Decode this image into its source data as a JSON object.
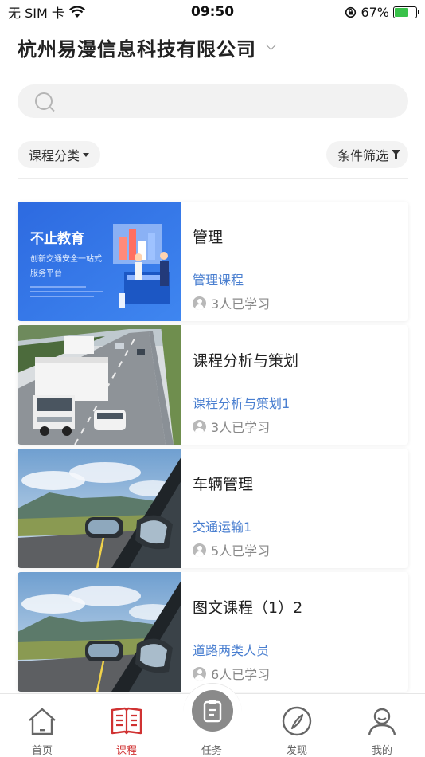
{
  "status": {
    "carrier": "无 SIM 卡",
    "time": "09:50",
    "battery": "67%",
    "battery_level": 0.67
  },
  "header": {
    "company_name": "杭州易漫信息科技有限公司"
  },
  "search": {
    "placeholder": ""
  },
  "filters": {
    "category_label": "课程分类",
    "condition_label": "条件筛选"
  },
  "banner": {
    "title": "不止教育",
    "line1": "创新交通安全一站式",
    "line2": "服务平台"
  },
  "courses": [
    {
      "title": "管理",
      "category": "管理课程",
      "learners": "3人已学习",
      "thumb": "banner"
    },
    {
      "title": "课程分析与策划",
      "category": "课程分析与策划1",
      "learners": "3人已学习",
      "thumb": "highway"
    },
    {
      "title": "车辆管理",
      "category": "交通运输1",
      "learners": "5人已学习",
      "thumb": "carmirror"
    },
    {
      "title": "图文课程（1）2",
      "category": "道路两类人员",
      "learners": "6人已学习",
      "thumb": "carmirror"
    }
  ],
  "tabbar": {
    "home": "首页",
    "course": "课程",
    "task": "任务",
    "discover": "发现",
    "mine": "我的",
    "active": "course"
  },
  "colors": {
    "accent": "#d03232",
    "link": "#4a7fd0",
    "banner_blue": "#2f6fdc"
  }
}
